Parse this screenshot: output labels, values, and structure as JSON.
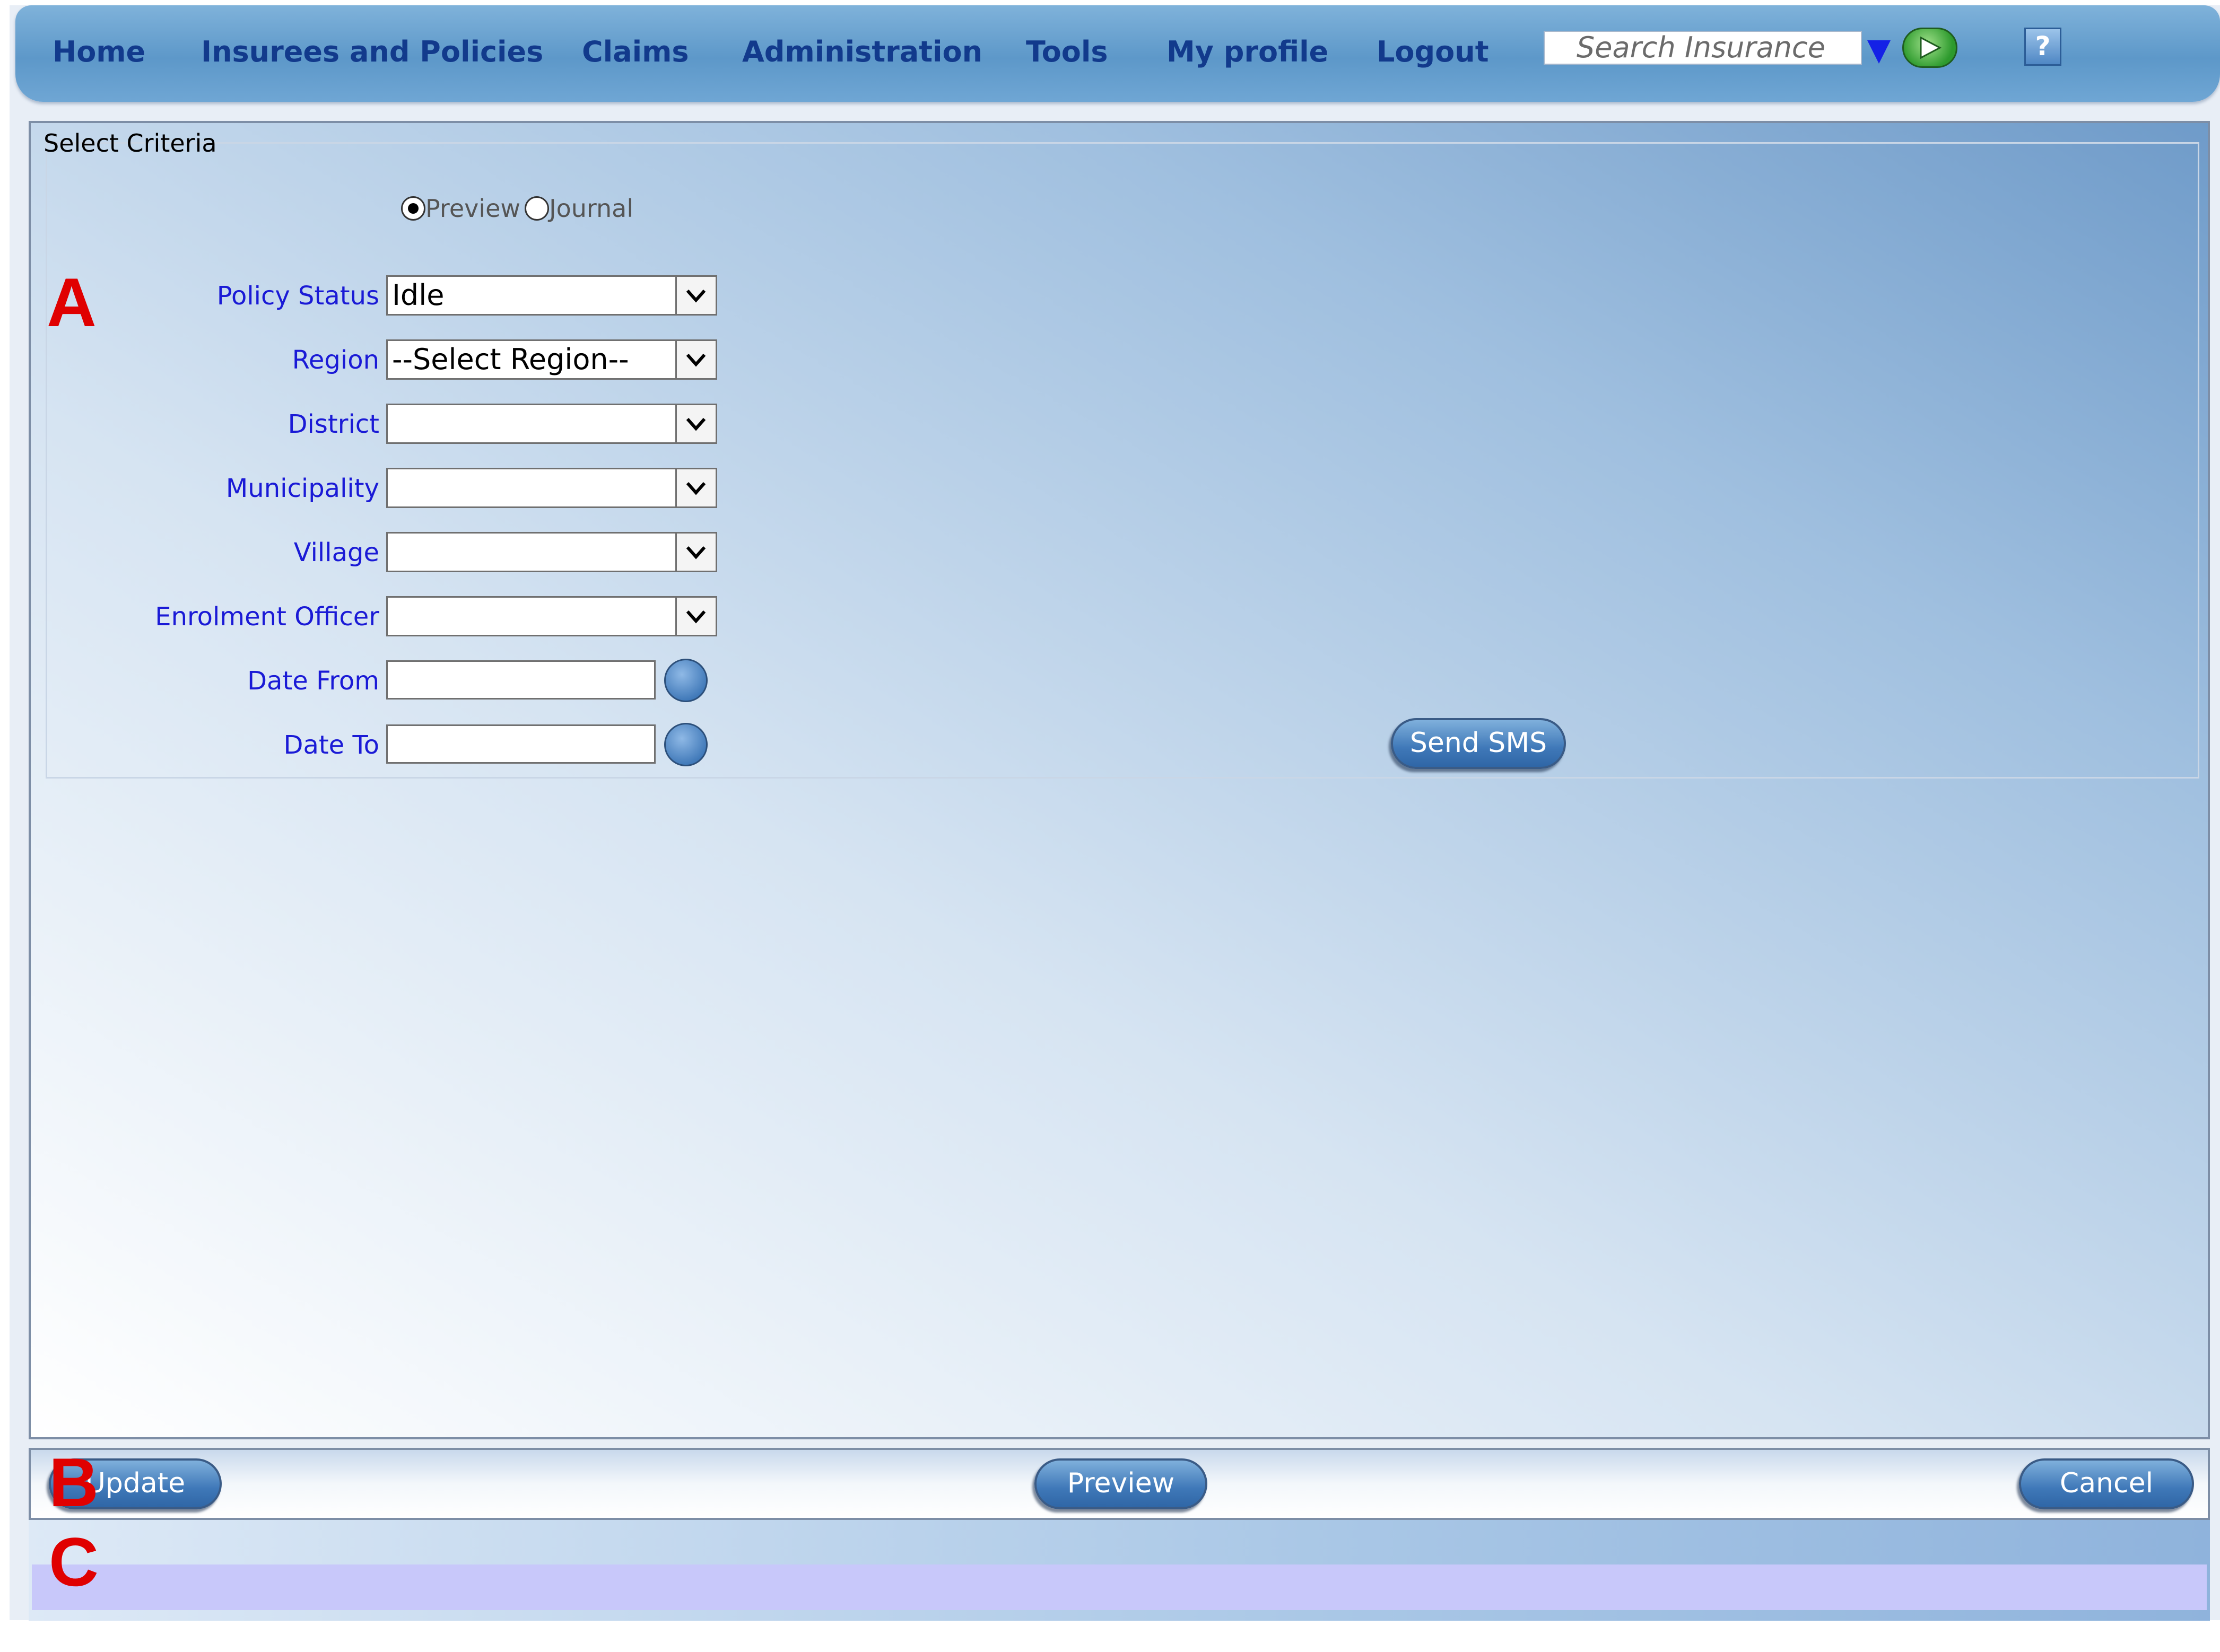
{
  "nav": {
    "items": [
      {
        "label": "Home"
      },
      {
        "label": "Insurees and Policies"
      },
      {
        "label": "Claims"
      },
      {
        "label": "Administration"
      },
      {
        "label": "Tools"
      },
      {
        "label": "My profile"
      },
      {
        "label": "Logout"
      }
    ],
    "search_placeholder": "Search Insurance",
    "help_icon": "?"
  },
  "criteria": {
    "legend": "Select Criteria",
    "mode_options": [
      {
        "label": "Preview",
        "checked": true
      },
      {
        "label": "Journal",
        "checked": false
      }
    ],
    "fields": {
      "policy_status": {
        "label": "Policy Status",
        "value": "Idle"
      },
      "region": {
        "label": "Region",
        "value": "--Select Region--"
      },
      "district": {
        "label": "District",
        "value": ""
      },
      "municipality": {
        "label": "Municipality",
        "value": ""
      },
      "village": {
        "label": "Village",
        "value": ""
      },
      "enrolment_officer": {
        "label": "Enrolment Officer",
        "value": ""
      },
      "date_from": {
        "label": "Date From",
        "value": ""
      },
      "date_to": {
        "label": "Date To",
        "value": ""
      }
    },
    "send_sms_label": "Send SMS"
  },
  "footer": {
    "update_label": "Update",
    "preview_label": "Preview",
    "cancel_label": "Cancel"
  },
  "markers": {
    "a": "A",
    "b": "B",
    "c": "C"
  },
  "colors": {
    "nav_text": "#123a8c",
    "field_label": "#1a1ad6",
    "marker": "#e00000",
    "status_bar": "#c8c8fa",
    "button": "#3f78b8"
  }
}
